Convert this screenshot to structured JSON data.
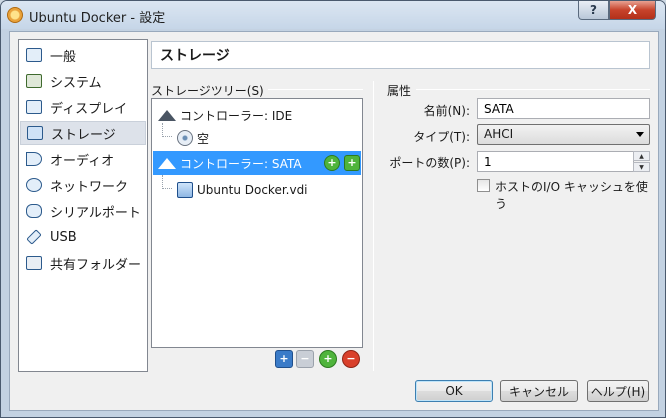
{
  "window": {
    "title": "Ubuntu Docker - 設定"
  },
  "titlebar": {
    "help_glyph": "?",
    "close_glyph": "X"
  },
  "sidebar": {
    "items": [
      {
        "label": "一般",
        "icon": "monitor-icon"
      },
      {
        "label": "システム",
        "icon": "chip-icon"
      },
      {
        "label": "ディスプレイ",
        "icon": "display-icon"
      },
      {
        "label": "ストレージ",
        "icon": "storage-icon",
        "selected": true
      },
      {
        "label": "オーディオ",
        "icon": "speaker-icon"
      },
      {
        "label": "ネットワーク",
        "icon": "network-icon"
      },
      {
        "label": "シリアルポート",
        "icon": "serial-port-icon"
      },
      {
        "label": "USB",
        "icon": "usb-icon"
      },
      {
        "label": "共有フォルダー",
        "icon": "folder-icon"
      }
    ]
  },
  "page": {
    "title": "ストレージ"
  },
  "storage_tree": {
    "label": "ストレージツリー(S)",
    "rows": [
      {
        "label": "コントローラー: IDE",
        "type": "controller"
      },
      {
        "label": "空",
        "type": "optical-disc"
      },
      {
        "label": "コントローラー: SATA",
        "type": "controller",
        "selected": true
      },
      {
        "label": "Ubuntu Docker.vdi",
        "type": "hard-disk"
      }
    ],
    "row_actions": {
      "add_cd": "+",
      "add_hdd": "+"
    },
    "toolbar": {
      "add_controller": "+",
      "remove_controller": "−",
      "add_attachment": "+",
      "remove_attachment": "−"
    }
  },
  "attributes": {
    "label": "属性",
    "name_label": "名前(N):",
    "name_value": "SATA",
    "type_label": "タイプ(T):",
    "type_value": "AHCI",
    "port_count_label": "ポートの数(P):",
    "port_count_value": "1",
    "host_io_cache_label": "ホストのI/O キャッシュを使う",
    "host_io_cache_checked": false
  },
  "buttons": {
    "ok": "OK",
    "cancel": "キャンセル",
    "help": "ヘルプ(H)"
  }
}
